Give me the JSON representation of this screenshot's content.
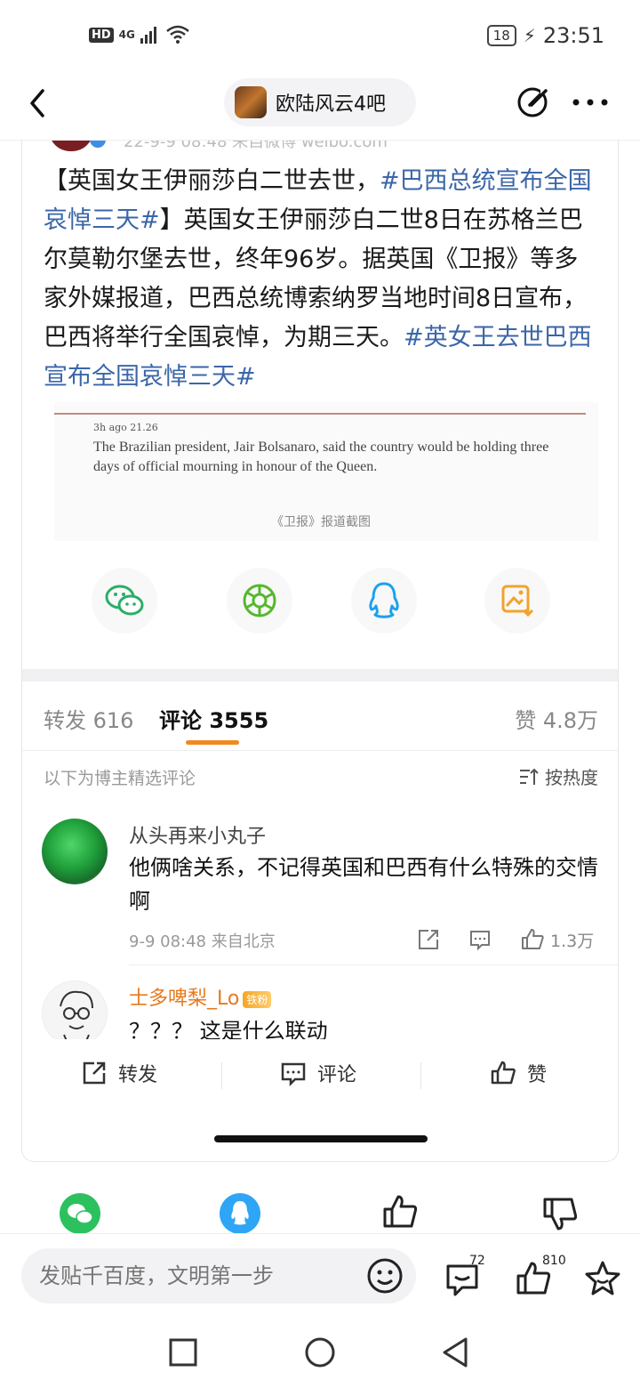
{
  "status_bar": {
    "network": "4G",
    "hd": "HD",
    "battery": "18",
    "time": "23:51"
  },
  "nav": {
    "forum_name": "欧陆风云4吧"
  },
  "post": {
    "meta_partial": "22-9-9 08:48 来自微博 weibo.com",
    "text_1": "【英国女王伊丽莎白二世去世，",
    "tag_1": "#巴西总统宣布全国哀悼三天#",
    "text_2": "】英国女王伊丽莎白二世8日在苏格兰巴尔莫勒尔堡去世，终年96岁。据英国《卫报》等多家外媒报道，巴西总统博索纳罗当地时间8日宣布，巴西将举行全国哀悼，为期三天。",
    "tag_2": "#英女王去世巴西宣布全国哀悼三天#",
    "quote_meta": "3h ago   21.26",
    "quote_text": "The Brazilian president, Jair Bolsanaro, said the country would be holding three days of official mourning in honour of the Queen.",
    "quote_caption": "《卫报》报道截图"
  },
  "share_icons": [
    "wechat-icon",
    "moments-icon",
    "qq-icon",
    "save-image-icon"
  ],
  "tabs": {
    "repost": "转发 616",
    "comments": "评论 3555",
    "likes": "赞 4.8万"
  },
  "filter": {
    "label": "以下为博主精选评论",
    "sort": "按热度"
  },
  "comments": [
    {
      "user": "从头再来小丸子",
      "text": "他俩啥关系，不记得英国和巴西有什么特殊的交情啊",
      "time": "9-9 08:48 来自北京",
      "likes": "1.3万"
    },
    {
      "user": "士多啤梨_Lo",
      "badge": "铁粉",
      "text": "？？？ 这是什么联动"
    }
  ],
  "action_bar": {
    "repost": "转发",
    "comment": "评论",
    "like": "赞"
  },
  "input_bar": {
    "placeholder": "发贴千百度，文明第一步",
    "comment_count": "72",
    "like_count": "810"
  },
  "colors": {
    "accent": "#f08a1e",
    "tag": "#3b66a8",
    "username_highlight": "#e8791c"
  }
}
